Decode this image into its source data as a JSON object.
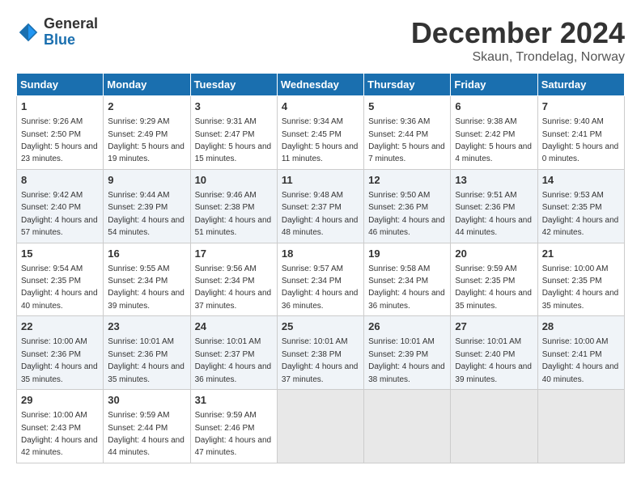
{
  "logo": {
    "general": "General",
    "blue": "Blue"
  },
  "header": {
    "month": "December 2024",
    "location": "Skaun, Trondelag, Norway"
  },
  "weekdays": [
    "Sunday",
    "Monday",
    "Tuesday",
    "Wednesday",
    "Thursday",
    "Friday",
    "Saturday"
  ],
  "weeks": [
    [
      {
        "day": "1",
        "sunrise": "9:26 AM",
        "sunset": "2:50 PM",
        "daylight": "5 hours and 23 minutes."
      },
      {
        "day": "2",
        "sunrise": "9:29 AM",
        "sunset": "2:49 PM",
        "daylight": "5 hours and 19 minutes."
      },
      {
        "day": "3",
        "sunrise": "9:31 AM",
        "sunset": "2:47 PM",
        "daylight": "5 hours and 15 minutes."
      },
      {
        "day": "4",
        "sunrise": "9:34 AM",
        "sunset": "2:45 PM",
        "daylight": "5 hours and 11 minutes."
      },
      {
        "day": "5",
        "sunrise": "9:36 AM",
        "sunset": "2:44 PM",
        "daylight": "5 hours and 7 minutes."
      },
      {
        "day": "6",
        "sunrise": "9:38 AM",
        "sunset": "2:42 PM",
        "daylight": "5 hours and 4 minutes."
      },
      {
        "day": "7",
        "sunrise": "9:40 AM",
        "sunset": "2:41 PM",
        "daylight": "5 hours and 0 minutes."
      }
    ],
    [
      {
        "day": "8",
        "sunrise": "9:42 AM",
        "sunset": "2:40 PM",
        "daylight": "4 hours and 57 minutes."
      },
      {
        "day": "9",
        "sunrise": "9:44 AM",
        "sunset": "2:39 PM",
        "daylight": "4 hours and 54 minutes."
      },
      {
        "day": "10",
        "sunrise": "9:46 AM",
        "sunset": "2:38 PM",
        "daylight": "4 hours and 51 minutes."
      },
      {
        "day": "11",
        "sunrise": "9:48 AM",
        "sunset": "2:37 PM",
        "daylight": "4 hours and 48 minutes."
      },
      {
        "day": "12",
        "sunrise": "9:50 AM",
        "sunset": "2:36 PM",
        "daylight": "4 hours and 46 minutes."
      },
      {
        "day": "13",
        "sunrise": "9:51 AM",
        "sunset": "2:36 PM",
        "daylight": "4 hours and 44 minutes."
      },
      {
        "day": "14",
        "sunrise": "9:53 AM",
        "sunset": "2:35 PM",
        "daylight": "4 hours and 42 minutes."
      }
    ],
    [
      {
        "day": "15",
        "sunrise": "9:54 AM",
        "sunset": "2:35 PM",
        "daylight": "4 hours and 40 minutes."
      },
      {
        "day": "16",
        "sunrise": "9:55 AM",
        "sunset": "2:34 PM",
        "daylight": "4 hours and 39 minutes."
      },
      {
        "day": "17",
        "sunrise": "9:56 AM",
        "sunset": "2:34 PM",
        "daylight": "4 hours and 37 minutes."
      },
      {
        "day": "18",
        "sunrise": "9:57 AM",
        "sunset": "2:34 PM",
        "daylight": "4 hours and 36 minutes."
      },
      {
        "day": "19",
        "sunrise": "9:58 AM",
        "sunset": "2:34 PM",
        "daylight": "4 hours and 36 minutes."
      },
      {
        "day": "20",
        "sunrise": "9:59 AM",
        "sunset": "2:35 PM",
        "daylight": "4 hours and 35 minutes."
      },
      {
        "day": "21",
        "sunrise": "10:00 AM",
        "sunset": "2:35 PM",
        "daylight": "4 hours and 35 minutes."
      }
    ],
    [
      {
        "day": "22",
        "sunrise": "10:00 AM",
        "sunset": "2:36 PM",
        "daylight": "4 hours and 35 minutes."
      },
      {
        "day": "23",
        "sunrise": "10:01 AM",
        "sunset": "2:36 PM",
        "daylight": "4 hours and 35 minutes."
      },
      {
        "day": "24",
        "sunrise": "10:01 AM",
        "sunset": "2:37 PM",
        "daylight": "4 hours and 36 minutes."
      },
      {
        "day": "25",
        "sunrise": "10:01 AM",
        "sunset": "2:38 PM",
        "daylight": "4 hours and 37 minutes."
      },
      {
        "day": "26",
        "sunrise": "10:01 AM",
        "sunset": "2:39 PM",
        "daylight": "4 hours and 38 minutes."
      },
      {
        "day": "27",
        "sunrise": "10:01 AM",
        "sunset": "2:40 PM",
        "daylight": "4 hours and 39 minutes."
      },
      {
        "day": "28",
        "sunrise": "10:00 AM",
        "sunset": "2:41 PM",
        "daylight": "4 hours and 40 minutes."
      }
    ],
    [
      {
        "day": "29",
        "sunrise": "10:00 AM",
        "sunset": "2:43 PM",
        "daylight": "4 hours and 42 minutes."
      },
      {
        "day": "30",
        "sunrise": "9:59 AM",
        "sunset": "2:44 PM",
        "daylight": "4 hours and 44 minutes."
      },
      {
        "day": "31",
        "sunrise": "9:59 AM",
        "sunset": "2:46 PM",
        "daylight": "4 hours and 47 minutes."
      },
      null,
      null,
      null,
      null
    ]
  ],
  "labels": {
    "sunrise": "Sunrise:",
    "sunset": "Sunset:",
    "daylight": "Daylight:"
  }
}
